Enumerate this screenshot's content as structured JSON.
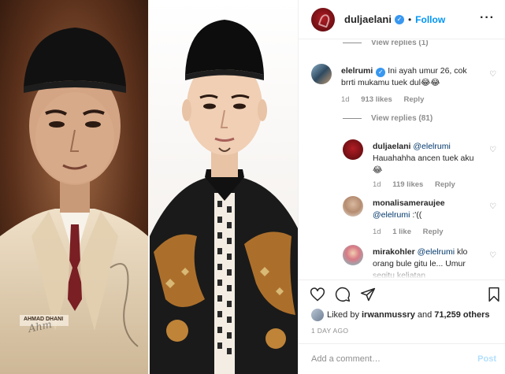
{
  "photo": {
    "left_caption": "AHMAD DHANI",
    "signature": "Ahm"
  },
  "header": {
    "username": "duljaelani",
    "separator": "•",
    "follow_label": "Follow"
  },
  "comments": {
    "top_view_replies": "View replies (1)",
    "items": [
      {
        "username": "elelrumi",
        "text": "Ini ayah umur 26, cok brrti mukamu tuek dul😂😂",
        "age": "1d",
        "likes": "913 likes",
        "reply": "Reply"
      }
    ],
    "view_replies": "View replies (81)",
    "replies": [
      {
        "username": "duljaelani",
        "mention": "@elelrumi",
        "text": "Hauahahha ancen tuek aku 😂",
        "age": "1d",
        "likes": "119 likes",
        "reply": "Reply"
      },
      {
        "username": "monalisameraujee",
        "mention": "@elelrumi",
        "text": ":'((",
        "age": "1d",
        "likes": "1 like",
        "reply": "Reply"
      },
      {
        "username": "mirakohler",
        "mention": "@elelrumi",
        "text": "klo orang bule gitu le... Umur segitu keliatan",
        "age": "",
        "likes": "",
        "reply": ""
      }
    ]
  },
  "likes": {
    "prefix": "Liked by",
    "user": "irwanmussry",
    "connector": "and",
    "others": "71,259 others"
  },
  "date": "1 DAY AGO",
  "add_comment": {
    "placeholder": "Add a comment…",
    "post_label": "Post"
  },
  "colors": {
    "accent": "#0095f6",
    "verified": "#3897f0",
    "muted": "#8e8e8e",
    "post_disabled": "#b2dffc"
  }
}
